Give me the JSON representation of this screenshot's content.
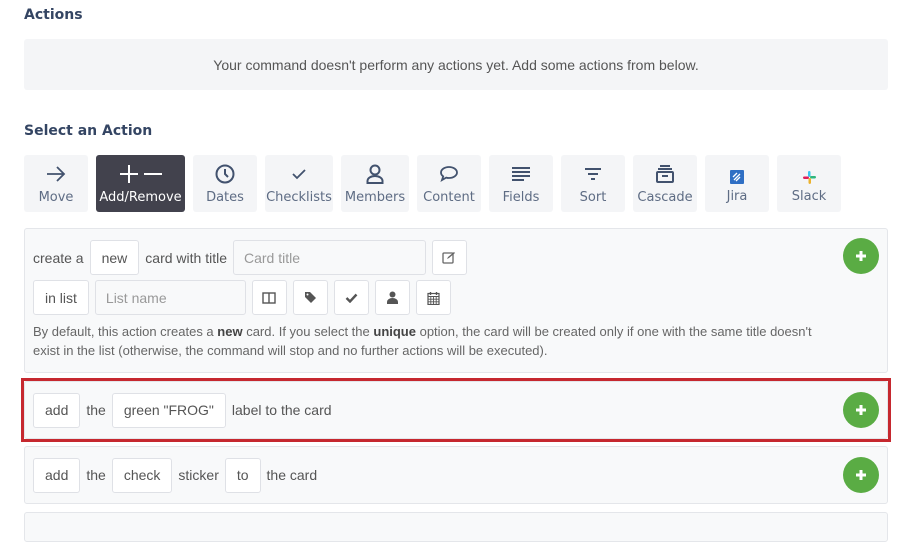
{
  "actions_section": {
    "title": "Actions",
    "empty_message": "Your command doesn't perform any actions yet. Add some actions from below."
  },
  "select_section": {
    "title": "Select an Action",
    "tiles": [
      {
        "label": "Move",
        "icon": "arrow-right-icon",
        "active": false
      },
      {
        "label": "Add/Remove",
        "icon": "plus-minus-icon",
        "active": true
      },
      {
        "label": "Dates",
        "icon": "clock-icon",
        "active": false
      },
      {
        "label": "Checklists",
        "icon": "check-icon",
        "active": false
      },
      {
        "label": "Members",
        "icon": "person-icon",
        "active": false
      },
      {
        "label": "Content",
        "icon": "speech-bubble-icon",
        "active": false
      },
      {
        "label": "Fields",
        "icon": "lines-icon",
        "active": false
      },
      {
        "label": "Sort",
        "icon": "sort-icon",
        "active": false
      },
      {
        "label": "Cascade",
        "icon": "archive-icon",
        "active": false
      },
      {
        "label": "Jira",
        "icon": "jira-icon",
        "active": false
      },
      {
        "label": "Slack",
        "icon": "slack-icon",
        "active": false
      }
    ]
  },
  "create_card_action": {
    "prefix": "create a",
    "mode_chip": "new",
    "middle": "card with title",
    "title_placeholder": "Card title",
    "list_chip": "in list",
    "list_placeholder": "List name",
    "note_parts": {
      "p1": "By default, this action creates a ",
      "b1": "new",
      "p2": " card. If you select the ",
      "b2": "unique",
      "p3": " option, the card will be created only if one with the same title doesn't exist in the list (otherwise, the command will stop and no further actions will be executed)."
    }
  },
  "label_action": {
    "verb_chip": "add",
    "the": "the",
    "label_chip": "green \"FROG\"",
    "suffix": "label to the card"
  },
  "sticker_action": {
    "verb_chip": "add",
    "the": "the",
    "sticker_chip": "check",
    "sticker_word": "sticker",
    "prep_chip": "to",
    "suffix": "the card"
  },
  "colors": {
    "active_tile": "#42424d",
    "add_button": "#5aac44",
    "highlight": "#c6282f"
  }
}
